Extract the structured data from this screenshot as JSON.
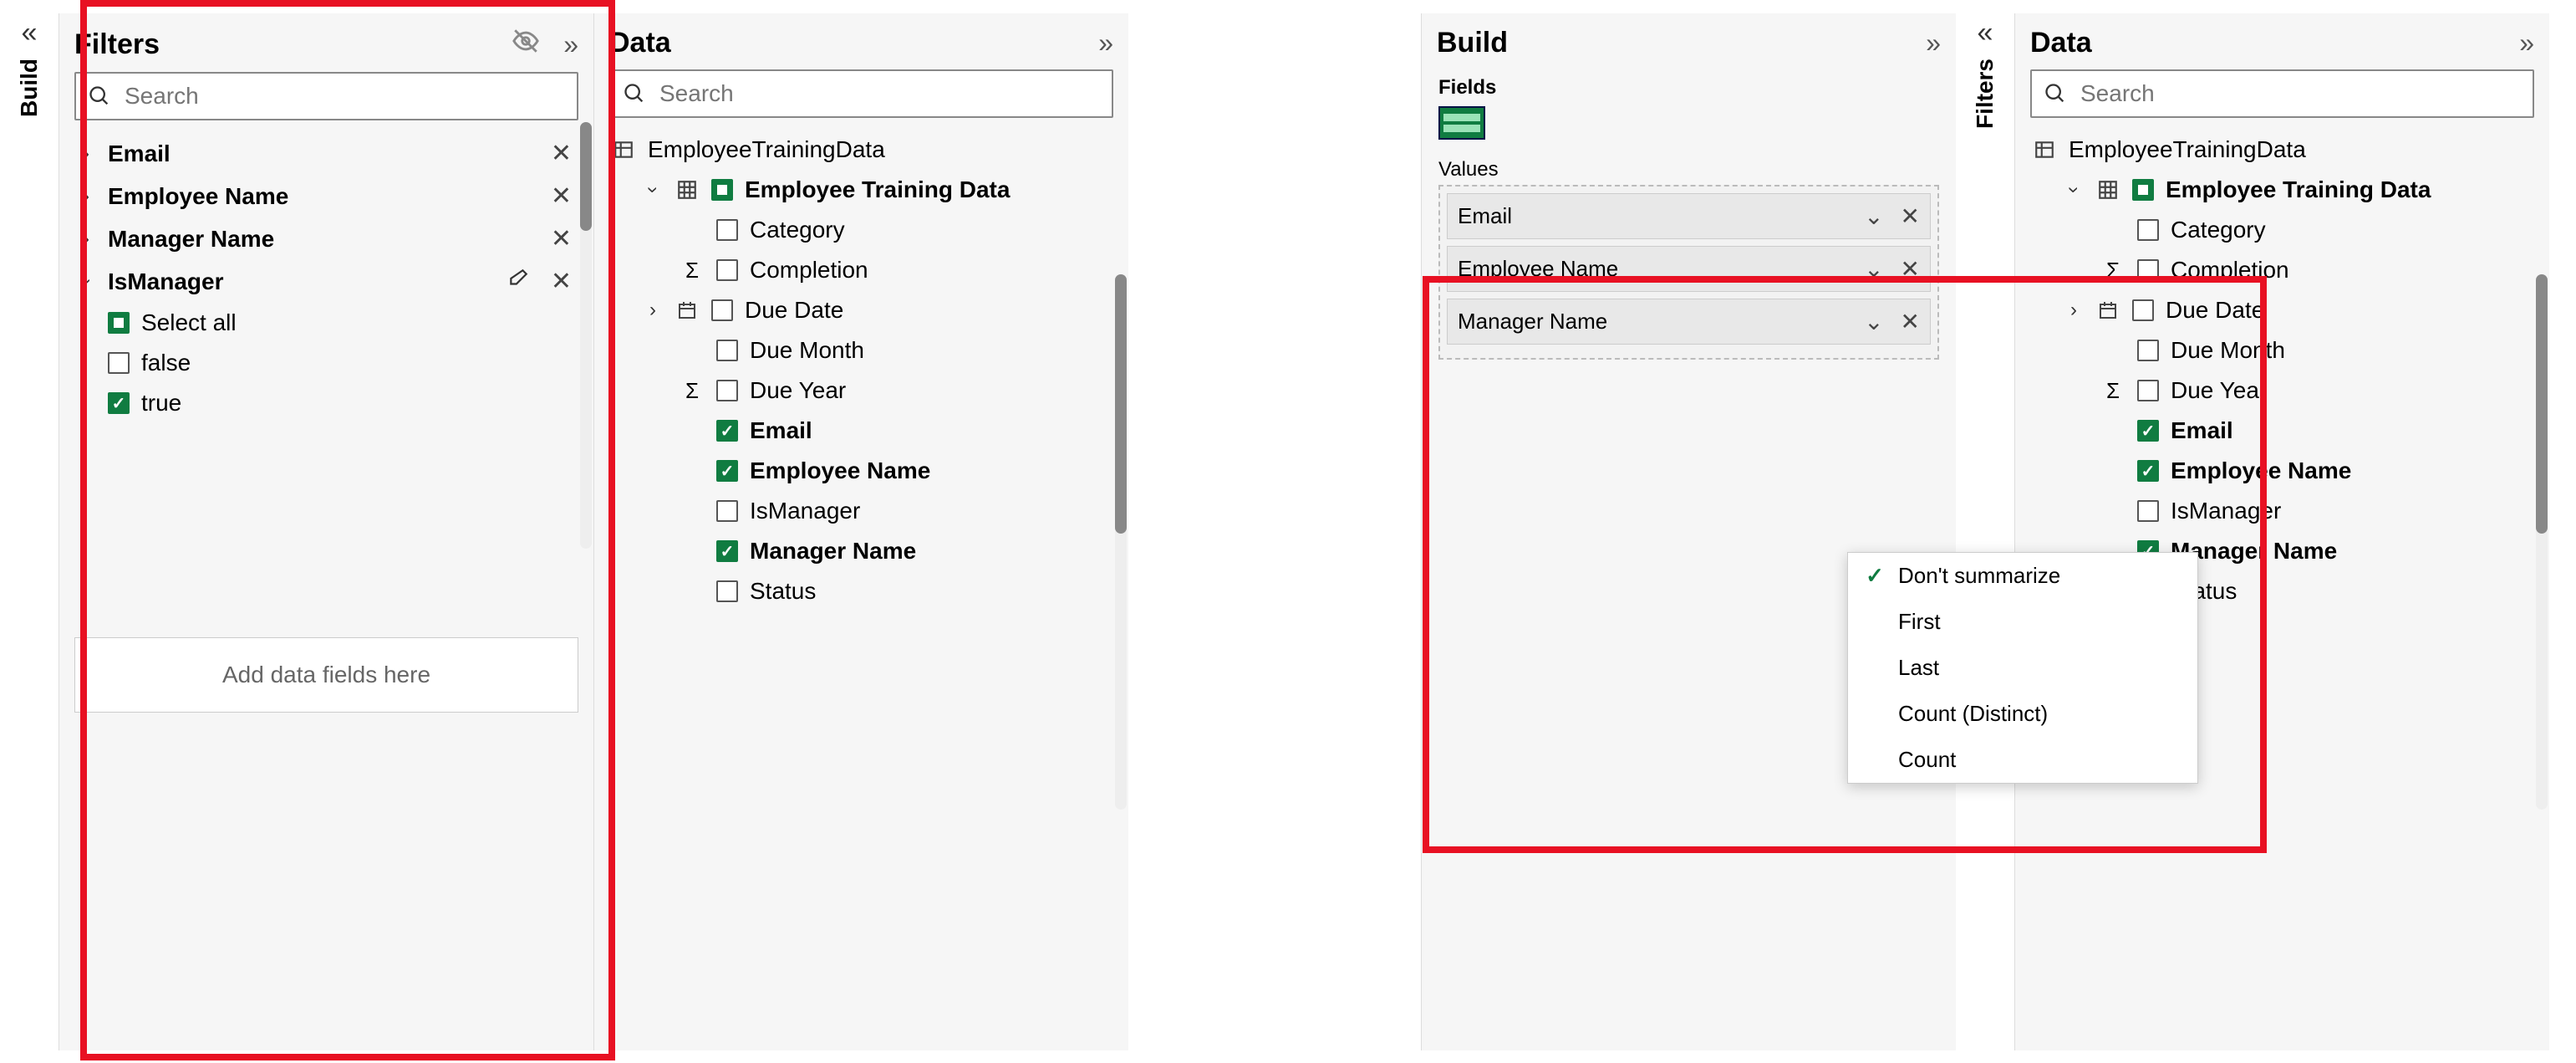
{
  "left": {
    "rail_build": "Build",
    "filters": {
      "title": "Filters",
      "search_placeholder": "Search",
      "items": [
        {
          "label": "Email"
        },
        {
          "label": "Employee Name"
        },
        {
          "label": "Manager Name"
        }
      ],
      "expanded": {
        "label": "IsManager",
        "select_all": "Select all",
        "opt_false": "false",
        "opt_true": "true"
      },
      "drop_text": "Add data fields here"
    },
    "data": {
      "title": "Data",
      "search_placeholder": "Search",
      "dataset": "EmployeeTrainingData",
      "table": "Employee Training Data",
      "fields": {
        "category": "Category",
        "completion": "Completion",
        "due_date": "Due Date",
        "due_month": "Due Month",
        "due_year": "Due Year",
        "email": "Email",
        "employee_name": "Employee Name",
        "ismanager": "IsManager",
        "manager_name": "Manager Name",
        "status": "Status"
      }
    }
  },
  "right": {
    "build": {
      "title": "Build",
      "fields_label": "Fields",
      "values_label": "Values",
      "values": [
        {
          "label": "Email"
        },
        {
          "label": "Employee Name"
        },
        {
          "label": "Manager Name"
        }
      ],
      "menu": {
        "dont_summarize": "Don't summarize",
        "first": "First",
        "last": "Last",
        "count_distinct": "Count (Distinct)",
        "count": "Count"
      }
    },
    "rail_filters": "Filters",
    "data": {
      "title": "Data",
      "search_placeholder": "Search",
      "dataset": "EmployeeTrainingData",
      "table": "Employee Training Data",
      "fields": {
        "category": "Category",
        "completion": "Completion",
        "due_date": "Due Date",
        "due_month": "Due Month",
        "due_year": "Due Year",
        "email": "Email",
        "employee_name": "Employee Name",
        "ismanager": "IsManager",
        "manager_name": "Manager Name",
        "status": "Status"
      }
    }
  }
}
